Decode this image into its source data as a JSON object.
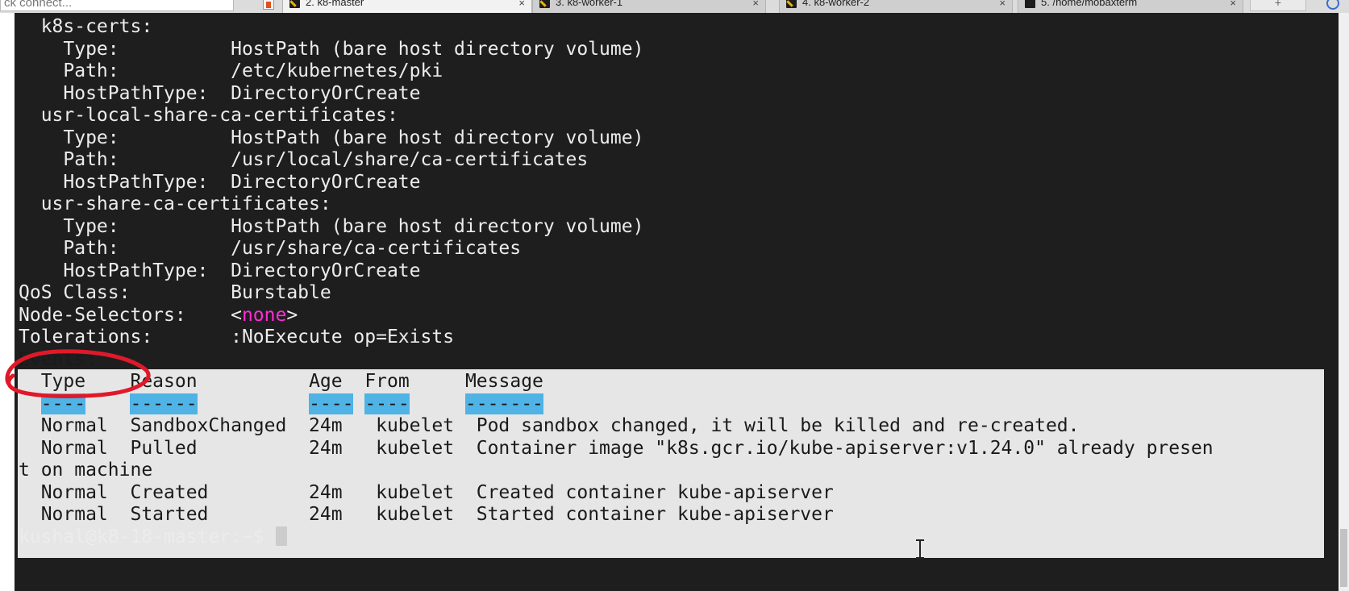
{
  "window": {
    "quick_connect": "ck connect...",
    "tabs": [
      {
        "label": "2. k8-master",
        "active": true
      },
      {
        "label": "3. k8-worker-1",
        "active": false
      },
      {
        "label": "4. k8-worker-2",
        "active": false
      },
      {
        "label": "5. /home/mobaxterm",
        "active": false
      }
    ]
  },
  "terminal": {
    "lines": [
      "  k8s-certs:",
      "    Type:          HostPath (bare host directory volume)",
      "    Path:          /etc/kubernetes/pki",
      "    HostPathType:  DirectoryOrCreate",
      "  usr-local-share-ca-certificates:",
      "    Type:          HostPath (bare host directory volume)",
      "    Path:          /usr/local/share/ca-certificates",
      "    HostPathType:  DirectoryOrCreate",
      "  usr-share-ca-certificates:",
      "    Type:          HostPath (bare host directory volume)",
      "    Path:          /usr/share/ca-certificates",
      "    HostPathType:  DirectoryOrCreate",
      "QoS Class:         Burstable"
    ],
    "node_selectors_prefix": "Node-Selectors:    <",
    "node_selectors_value": "none",
    "node_selectors_suffix": ">",
    "tolerations": "Tolerations:       :NoExecute op=Exists",
    "events_heading": "Events:",
    "events_header": {
      "type": "  Type",
      "gap1": "    ",
      "reason": "Reason",
      "gap2": "          ",
      "age": "Age",
      "gap3": "  ",
      "from": "From",
      "gap4": "     ",
      "message": "Message"
    },
    "events_underline": {
      "indent": "  ",
      "type": "----",
      "gap1": "    ",
      "reason": "------",
      "gap2": "          ",
      "age": "----",
      "gap3": " ",
      "from": "----",
      "gap4": "     ",
      "message": "-------"
    },
    "event_lines": [
      "  Normal  SandboxChanged  24m   kubelet  Pod sandbox changed, it will be killed and re-created.",
      "  Normal  Pulled          24m   kubelet  Container image \"k8s.gcr.io/kube-apiserver:v1.24.0\" already presen",
      "t on machine",
      "  Normal  Created         24m   kubelet  Created container kube-apiserver",
      "  Normal  Started         24m   kubelet  Started container kube-apiserver"
    ],
    "prompt": "kushal@k8-18-master:~$ "
  },
  "colors": {
    "terminal_bg": "#1e1e1e",
    "terminal_fg": "#ececec",
    "selection_bg": "#e6e6e6",
    "column_underline_highlight": "#4fb3e6",
    "none_text": "#ff2cd6",
    "annotation": "#e0192a"
  },
  "icons": [
    "home-icon",
    "terminal-tab-icon",
    "new-tab-icon",
    "settings-icon",
    "text-cursor-icon"
  ]
}
